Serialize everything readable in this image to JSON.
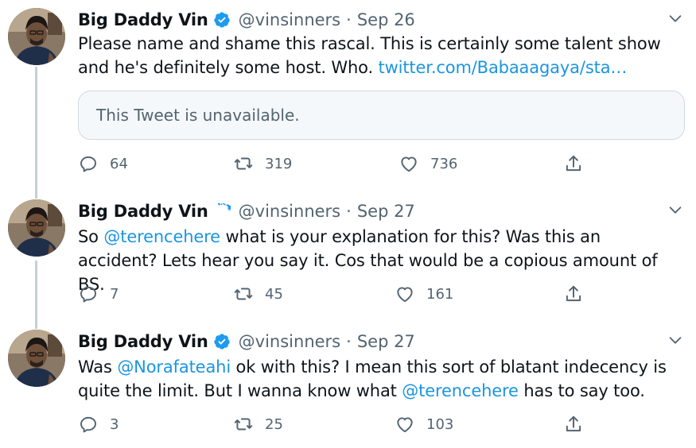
{
  "tweets": [
    {
      "author_name": "Big Daddy Vin",
      "handle": "@vinsinners",
      "dot": "·",
      "date": "Sep 26",
      "text_parts": [
        "Please name and shame this rascal. This is certainly some talent show and he's definitely some host. Who. ",
        "twitter.com/Babaaagaya/sta…"
      ],
      "quoted_tweet": "This Tweet is unavailable.",
      "replies": "64",
      "retweets": "319",
      "likes": "736"
    },
    {
      "author_name": "Big Daddy Vin",
      "handle": "@vinsinners",
      "dot": "·",
      "date": "Sep 27",
      "text_parts": [
        "So ",
        "@terencehere",
        " what is your explanation for this? Was this an accident? Lets hear you say it. Cos that would be a copious amount of BS."
      ],
      "replies": "7",
      "retweets": "45",
      "likes": "161"
    },
    {
      "author_name": "Big Daddy Vin",
      "handle": "@vinsinners",
      "dot": "·",
      "date": "Sep 27",
      "text_parts": [
        "Was ",
        "@Norafateahi",
        " ok with this? I mean this sort of blatant indecency is quite the limit. But I wanna know what ",
        "@terencehere",
        " has to say too."
      ],
      "replies": "3",
      "retweets": "25",
      "likes": "103"
    }
  ],
  "colors": {
    "link": "#1b95e0",
    "secondary_text": "#536471",
    "verified_badge": "#1d9bf0",
    "thread_line": "#c4cfd6"
  },
  "icons": [
    "reply-icon",
    "retweet-icon",
    "like-icon",
    "share-icon",
    "verified-badge-icon",
    "caret-down-icon"
  ]
}
